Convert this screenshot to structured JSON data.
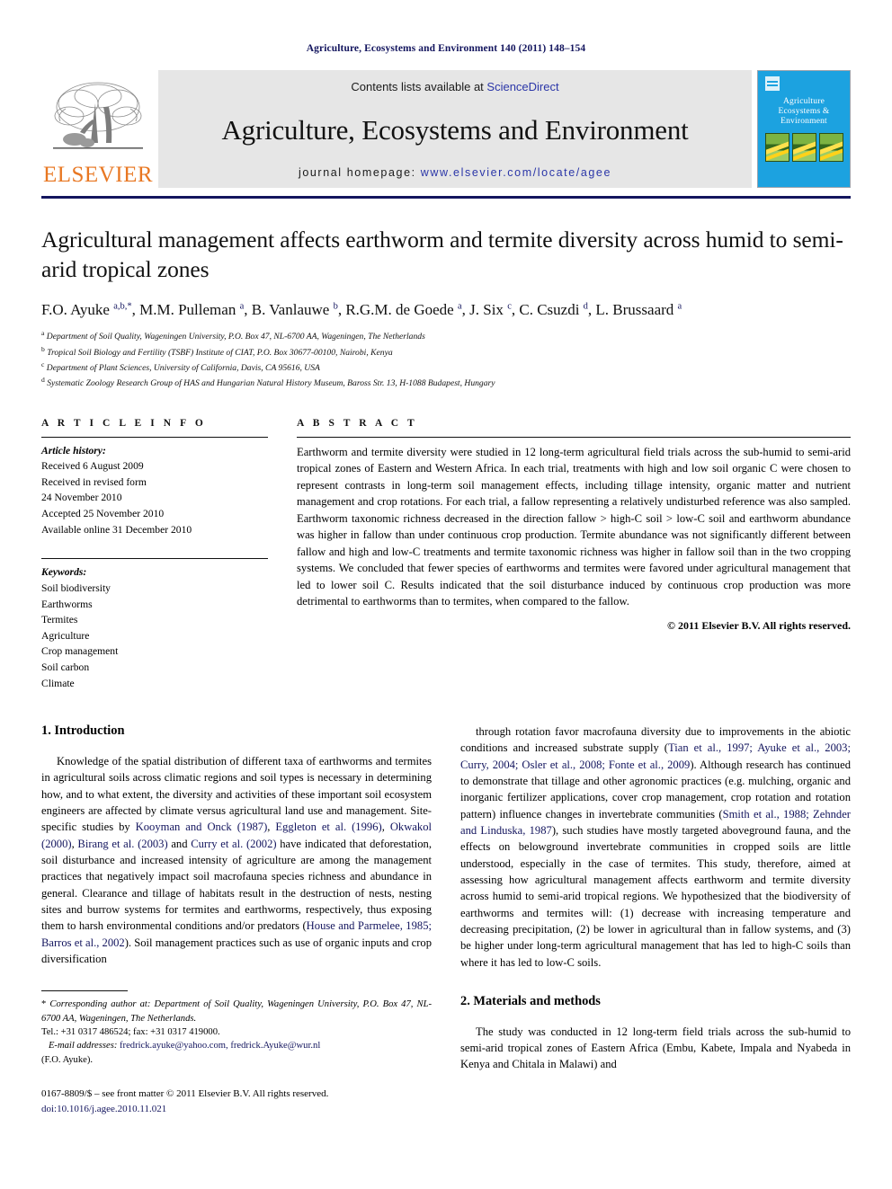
{
  "running_head": "Agriculture, Ecosystems and Environment 140 (2011) 148–154",
  "masthead": {
    "publisher_word": "ELSEVIER",
    "contents_prefix": "Contents lists available at ",
    "sciencedirect": "ScienceDirect",
    "journal_title": "Agriculture, Ecosystems and Environment",
    "homepage_label": "journal homepage: ",
    "homepage_url": "www.elsevier.com/locate/agee",
    "cover_title": "Agriculture\nEcosystems &\nEnvironment",
    "cover_color": "#1ca2e0",
    "link_color": "#2b36a8"
  },
  "article": {
    "title": "Agricultural management affects earthworm and termite diversity across humid to semi-arid tropical zones",
    "authors_html": "F.O. Ayuke <sup>a,b,*</sup>, M.M. Pulleman <sup>a</sup>, B. Vanlauwe <sup>b</sup>, R.G.M. de Goede <sup>a</sup>, J. Six <sup>c</sup>, C. Csuzdi <sup>d</sup>, L. Brussaard <sup>a</sup>",
    "affiliations": [
      "a Department of Soil Quality, Wageningen University, P.O. Box 47, NL-6700 AA, Wageningen, The Netherlands",
      "b Tropical Soil Biology and Fertility (TSBF) Institute of CIAT, P.O. Box 30677-00100, Nairobi, Kenya",
      "c Department of Plant Sciences, University of California, Davis, CA 95616, USA",
      "d Systematic Zoology Research Group of HAS and Hungarian Natural History Museum, Baross Str. 13, H-1088 Budapest, Hungary"
    ]
  },
  "article_info": {
    "heading": "A R T I C L E  I N F O",
    "history_label": "Article history:",
    "history": [
      "Received 6 August 2009",
      "Received in revised form",
      "24 November 2010",
      "Accepted 25 November 2010",
      "Available online 31 December 2010"
    ],
    "keywords_label": "Keywords:",
    "keywords": [
      "Soil biodiversity",
      "Earthworms",
      "Termites",
      "Agriculture",
      "Crop management",
      "Soil carbon",
      "Climate"
    ]
  },
  "abstract": {
    "heading": "A B S T R A C T",
    "text": "Earthworm and termite diversity were studied in 12 long-term agricultural field trials across the sub-humid to semi-arid tropical zones of Eastern and Western Africa. In each trial, treatments with high and low soil organic C were chosen to represent contrasts in long-term soil management effects, including tillage intensity, organic matter and nutrient management and crop rotations. For each trial, a fallow representing a relatively undisturbed reference was also sampled. Earthworm taxonomic richness decreased in the direction fallow > high-C soil > low-C soil and earthworm abundance was higher in fallow than under continuous crop production. Termite abundance was not significantly different between fallow and high and low-C treatments and termite taxonomic richness was higher in fallow soil than in the two cropping systems. We concluded that fewer species of earthworms and termites were favored under agricultural management that led to lower soil C. Results indicated that the soil disturbance induced by continuous crop production was more detrimental to earthworms than to termites, when compared to the fallow.",
    "copyright": "© 2011 Elsevier B.V. All rights reserved."
  },
  "sections": {
    "introduction_heading": "1. Introduction",
    "intro_left_html": "Knowledge of the spatial distribution of different taxa of earthworms and termites in agricultural soils across climatic regions and soil types is necessary in determining how, and to what extent, the diversity and activities of these important soil ecosystem engineers are affected by climate versus agricultural land use and management. Site-specific studies by <span class=\"ref\">Kooyman and Onck (1987)</span>, <span class=\"ref\">Eggleton et al. (1996)</span>, <span class=\"ref\">Okwakol (2000)</span>, <span class=\"ref\">Birang et al. (2003)</span> and <span class=\"ref\">Curry et al. (2002)</span> have indicated that deforestation, soil disturbance and increased intensity of agriculture are among the management practices that negatively impact soil macrofauna species richness and abundance in general. Clearance and tillage of habitats result in the destruction of nests, nesting sites and burrow systems for termites and earthworms, respectively, thus exposing them to harsh environmental conditions and/or predators (<span class=\"ref\">House and Parmelee, 1985; Barros et al., 2002</span>). Soil management practices such as use of organic inputs and crop diversification",
    "intro_right_html": "through rotation favor macrofauna diversity due to improvements in the abiotic conditions and increased substrate supply (<span class=\"ref\">Tian et al., 1997; Ayuke et al., 2003; Curry, 2004; Osler et al., 2008; Fonte et al., 2009</span>). Although research has continued to demonstrate that tillage and other agronomic practices (e.g. mulching, organic and inorganic fertilizer applications, cover crop management, crop rotation and rotation pattern) influence changes in invertebrate communities (<span class=\"ref\">Smith et al., 1988; Zehnder and Linduska, 1987</span>), such studies have mostly targeted aboveground fauna, and the effects on belowground invertebrate communities in cropped soils are little understood, especially in the case of termites. This study, therefore, aimed at assessing how agricultural management affects earthworm and termite diversity across humid to semi-arid tropical regions. We hypothesized that the biodiversity of earthworms and termites will: (1) decrease with increasing temperature and decreasing precipitation, (2) be lower in agricultural than in fallow systems, and (3) be higher under long-term agricultural management that has led to high-C soils than where it has led to low-C soils.",
    "methods_heading": "2. Materials and methods",
    "methods_para": "The study was conducted in 12 long-term field trials across the sub-humid to semi-arid tropical zones of Eastern Africa (Embu, Kabete, Impala and Nyabeda in Kenya and Chitala in Malawi) and"
  },
  "footnote": {
    "corresponding_html": "* <span class=\"ital\">Corresponding author at: Department of Soil Quality, Wageningen University, P.O. Box 47, NL-6700 AA, Wageningen, The Netherlands.</span>",
    "tel_line": "Tel.: +31 0317 486524; fax: +31 0317 419000.",
    "email_label": "E-mail addresses:",
    "emails": "fredrick.ayuke@yahoo.com, fredrick.Ayuke@wur.nl",
    "email_owner": "(F.O. Ayuke).",
    "imprint": "0167-8809/$ – see front matter © 2011 Elsevier B.V. All rights reserved.",
    "doi": "doi:10.1016/j.agee.2010.11.021"
  }
}
